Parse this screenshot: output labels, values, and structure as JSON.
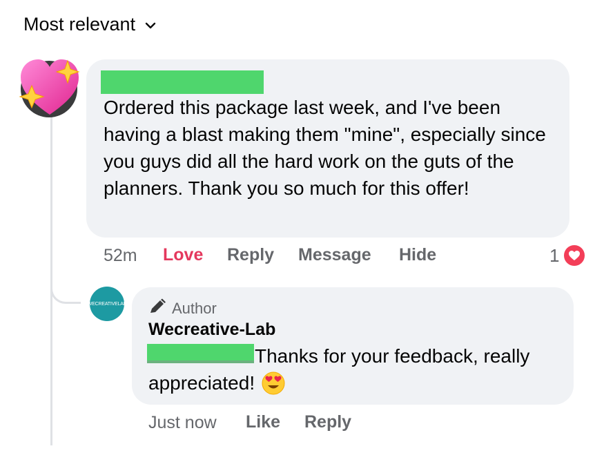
{
  "sort": {
    "label": "Most relevant",
    "icon": "chevron-down-icon"
  },
  "comment": {
    "avatar_icon": "sparkling-heart-icon",
    "body": "Ordered this package last week, and I've been having a blast making them \"mine\", especially since you guys did all the hard work on the guts of the planners. Thank you so much for this offer!",
    "time": "52m",
    "actions": {
      "love": "Love",
      "reply": "Reply",
      "message": "Message",
      "hide": "Hide"
    },
    "reaction_count": "1",
    "reaction_icon": "love-reaction-icon",
    "colors": {
      "love": "#e4385d",
      "redaction": "#4fd66d",
      "bubble": "#f0f2f5"
    }
  },
  "reply": {
    "avatar_text": "WECREATIVELAB",
    "badge_icon": "pencil-icon",
    "badge_label": "Author",
    "name": "Wecreative-Lab",
    "body_line1": "Thanks for your feedback, really",
    "body_line2": "appreciated!",
    "emoji": "heart-eyes-emoji-icon",
    "time": "Just now",
    "actions": {
      "like": "Like",
      "reply": "Reply"
    },
    "colors": {
      "avatar_bg": "#1d9aa2"
    }
  }
}
